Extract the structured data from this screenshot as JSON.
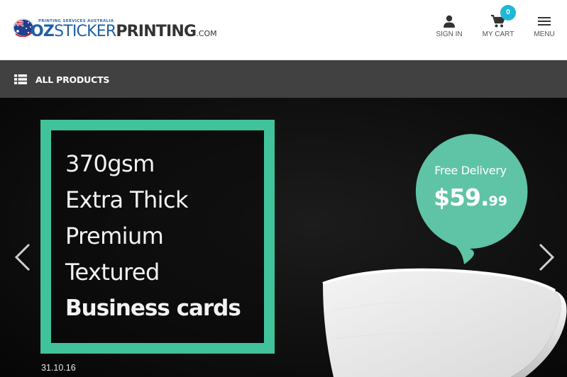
{
  "brand": {
    "tagline": "PRINTING SERVICES AUSTRALIA",
    "word_oz": "OZ",
    "word_sticker": "STICKER",
    "word_printing": "PRINTING",
    "word_com": ".COM",
    "colors": {
      "blue": "#1f5fa8",
      "dark": "#333333"
    }
  },
  "header": {
    "sign_in_label": "SIGN IN",
    "cart_label": "MY CART",
    "cart_count": "0",
    "menu_label": "MENU",
    "icons": {
      "sign_in": "user-icon",
      "cart": "cart-icon",
      "menu": "hamburger-icon"
    },
    "badge_color": "#1fb8d6"
  },
  "category_bar": {
    "label": "ALL PRODUCTS",
    "icon": "list-icon",
    "background": "#414141"
  },
  "hero": {
    "promo_lines": [
      "370gsm",
      "Extra Thick",
      "Premium",
      "Textured",
      "Business cards"
    ],
    "frame_color": "#41c29b",
    "bubble": {
      "subtitle": "Free Delivery",
      "price_main": "$59.",
      "price_cents": "99",
      "color": "#5fc3a6"
    },
    "date": "31.10.16",
    "nav": {
      "prev_icon": "chevron-left-icon",
      "next_icon": "chevron-right-icon"
    }
  }
}
